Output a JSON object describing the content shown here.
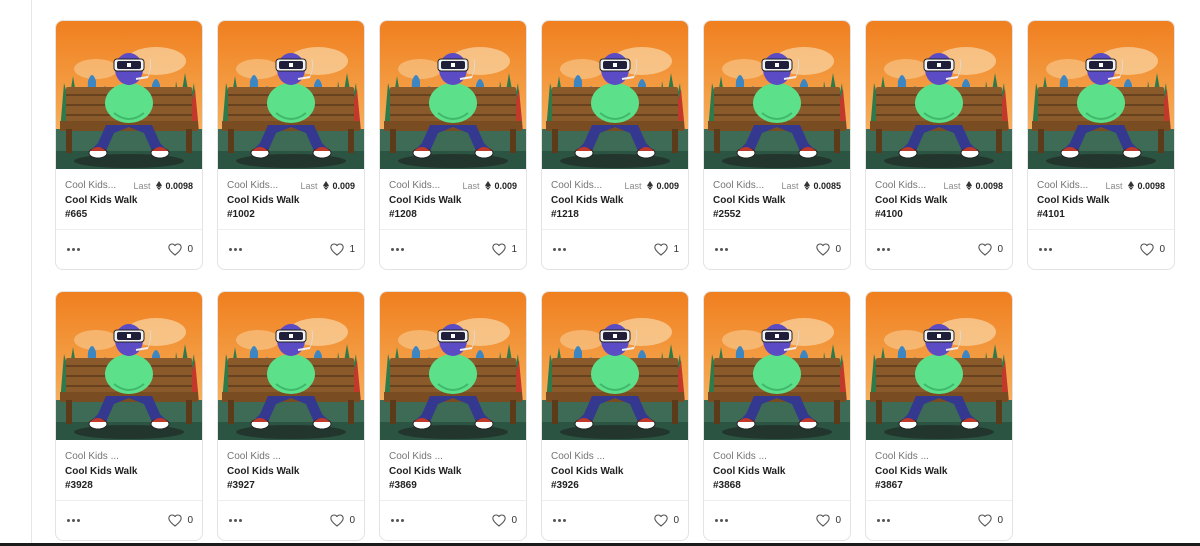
{
  "labels": {
    "last": "Last"
  },
  "colors": {
    "sky": "#f28c28",
    "grass": "#3d6b56",
    "hoodie": "#5ce08a",
    "pants": "#35388f"
  },
  "icons": {
    "more": "more-dots-icon",
    "favorite": "heart-icon",
    "currency": "eth-icon"
  },
  "row1": [
    {
      "collection": "Cool Kids...",
      "name": "Cool Kids Walk #665",
      "price": "0.0098",
      "favorites": "0"
    },
    {
      "collection": "Cool Kids...",
      "name": "Cool Kids Walk #1002",
      "price": "0.009",
      "favorites": "1"
    },
    {
      "collection": "Cool Kids...",
      "name": "Cool Kids Walk #1208",
      "price": "0.009",
      "favorites": "1"
    },
    {
      "collection": "Cool Kids...",
      "name": "Cool Kids Walk #1218",
      "price": "0.009",
      "favorites": "1"
    },
    {
      "collection": "Cool Kids...",
      "name": "Cool Kids Walk #2552",
      "price": "0.0085",
      "favorites": "0"
    },
    {
      "collection": "Cool Kids...",
      "name": "Cool Kids Walk #4100",
      "price": "0.0098",
      "favorites": "0"
    },
    {
      "collection": "Cool Kids...",
      "name": "Cool Kids Walk #4101",
      "price": "0.0098",
      "favorites": "0"
    }
  ],
  "row2": [
    {
      "collection": "Cool Kids ...",
      "name": "Cool Kids Walk #3928",
      "favorites": "0"
    },
    {
      "collection": "Cool Kids ...",
      "name": "Cool Kids Walk #3927",
      "favorites": "0"
    },
    {
      "collection": "Cool Kids ...",
      "name": "Cool Kids Walk #3869",
      "favorites": "0"
    },
    {
      "collection": "Cool Kids ...",
      "name": "Cool Kids Walk #3926",
      "favorites": "0"
    },
    {
      "collection": "Cool Kids ...",
      "name": "Cool Kids Walk #3868",
      "favorites": "0"
    },
    {
      "collection": "Cool Kids ...",
      "name": "Cool Kids Walk #3867",
      "favorites": "0"
    }
  ]
}
